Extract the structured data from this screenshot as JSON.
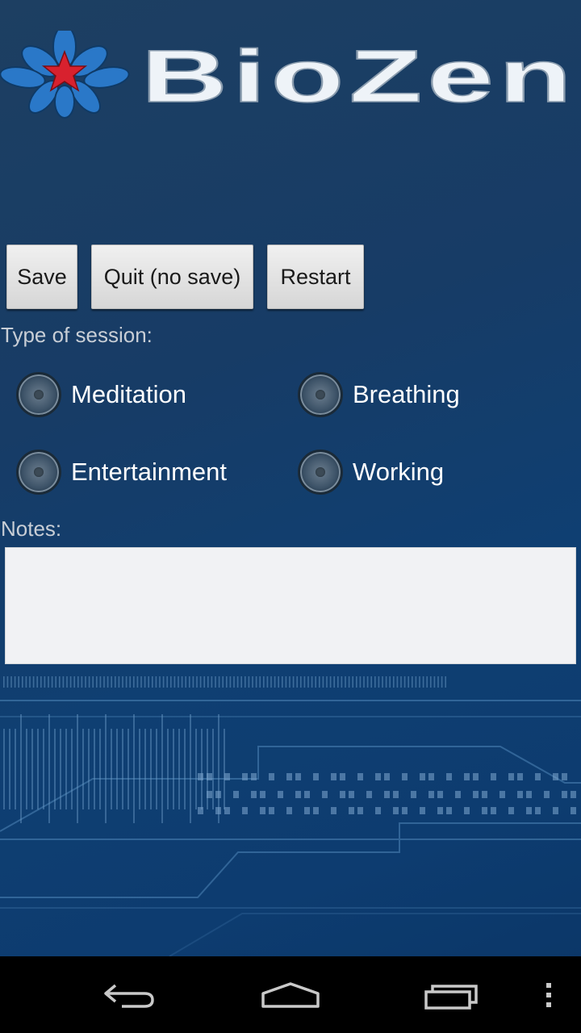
{
  "app": {
    "logo_text": "BioZen"
  },
  "toolbar": {
    "save_label": "Save",
    "quit_label": "Quit (no save)",
    "restart_label": "Restart"
  },
  "session": {
    "label": "Type of session:",
    "options": [
      {
        "label": "Meditation",
        "selected": false
      },
      {
        "label": "Breathing",
        "selected": false
      },
      {
        "label": "Entertainment",
        "selected": false
      },
      {
        "label": "Working",
        "selected": false
      }
    ]
  },
  "notes": {
    "label": "Notes:",
    "value": ""
  },
  "nav": {
    "icons": [
      "back-icon",
      "home-icon",
      "recent-apps-icon",
      "overflow-menu-icon"
    ]
  },
  "colors": {
    "background": "#173c66",
    "logo_blue": "#2f7fd0",
    "logo_star": "#d8212e",
    "text_white": "#ffffff"
  }
}
